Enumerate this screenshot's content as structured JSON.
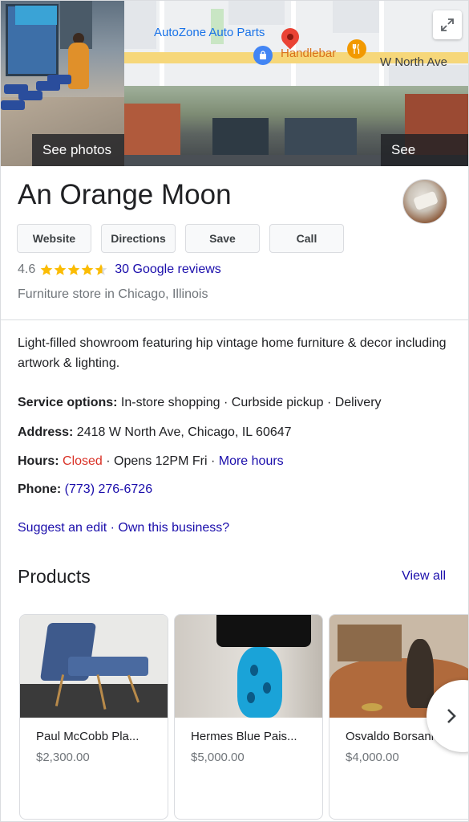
{
  "hero": {
    "see_photos": "See photos",
    "see_outside": "See outside",
    "map": {
      "poi_autozone": "AutoZone Auto Parts",
      "poi_handlebar": "Handlebar",
      "street": "W North Ave"
    }
  },
  "business": {
    "name": "An Orange Moon",
    "rating": "4.6",
    "stars": 4.6,
    "reviews_link": "30 Google reviews",
    "category": "Furniture store in Chicago, Illinois",
    "description": "Light-filled showroom featuring hip vintage home furniture & decor including artwork & lighting."
  },
  "actions": {
    "website": "Website",
    "directions": "Directions",
    "save": "Save",
    "call": "Call"
  },
  "info": {
    "service_label": "Service options:",
    "service_value": " In-store shopping · Curbside pickup · Delivery",
    "address_label": "Address:",
    "address_value": " 2418 W North Ave, Chicago, IL 60647",
    "hours_label": "Hours:",
    "hours_status": "Closed",
    "hours_sep1": " · Opens 12PM Fri · ",
    "hours_more": "More hours",
    "phone_label": "Phone:",
    "phone_value": "(773) 276-6726",
    "suggest_edit": "Suggest an edit",
    "sep": " · ",
    "own_business": "Own this business?"
  },
  "products": {
    "title": "Products",
    "view_all": "View all",
    "items": [
      {
        "name": "Paul McCobb Pla...",
        "price": "$2,300.00"
      },
      {
        "name": "Hermes Blue Pais...",
        "price": "$5,000.00"
      },
      {
        "name": "Osvaldo Borsani ...",
        "price": "$4,000.00"
      }
    ]
  },
  "colors": {
    "link": "#1a0dab",
    "closed": "#d93025",
    "star": "#fbbc04",
    "map_pin": "#ea4335"
  },
  "icons": [
    "expand-icon",
    "star-icon",
    "map-pin-icon",
    "shopping-bag-icon",
    "restaurant-icon",
    "chevron-right-icon"
  ]
}
